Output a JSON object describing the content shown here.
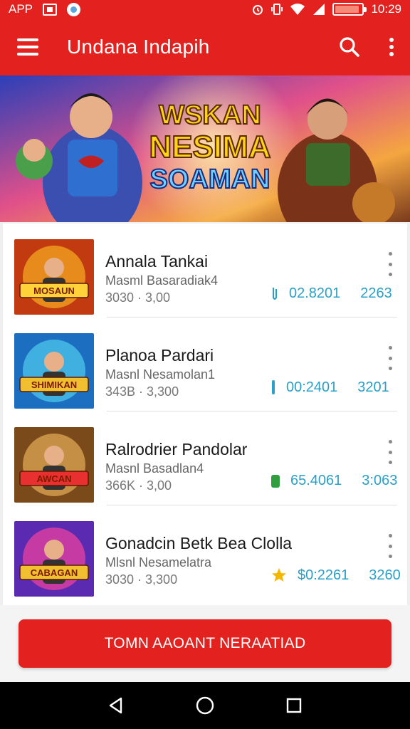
{
  "status_bar": {
    "left_text": "APP",
    "time": "10:29",
    "battery_level": 0.9,
    "icons": [
      "box-icon",
      "circle-app-icon",
      "alarm-icon",
      "vibrate-icon",
      "wifi-icon",
      "signal-icon",
      "battery-icon"
    ]
  },
  "app_bar": {
    "title": "Undana Indapih",
    "icons": [
      "menu-icon",
      "search-icon",
      "more-vert-icon"
    ]
  },
  "banner": {
    "line1": "WSKAN",
    "line2": "NESIMA",
    "line3": "SOAMAN"
  },
  "list": [
    {
      "title": "Annala Tankai",
      "subtitle": "Masml Basaradiak4",
      "meta": "3030 · 3,00",
      "stat_icon": "clip-icon",
      "stat_value": "02.8201",
      "stat_count": "2263",
      "thumb_text": "MOSAUN"
    },
    {
      "title": "Planoa Pardari",
      "subtitle": "Masnl Nesamolan1",
      "meta": "343B · 3,300",
      "stat_icon": "bar-icon",
      "stat_value": "00:2401",
      "stat_count": "3201",
      "thumb_text": "SHIMIKAN"
    },
    {
      "title": "Ralrodrier Pandolar",
      "subtitle": "Masnl Basadlan4",
      "meta": "366K · 3,00",
      "stat_icon": "green-tag-icon",
      "stat_value": "65.4061",
      "stat_count": "3:063",
      "thumb_text": "AWCAN"
    },
    {
      "title": "Gonadcin Betk Bea Clolla",
      "subtitle": "Mlsnl Nesamelatra",
      "meta": "3030 · 3,300",
      "stat_icon": "star-icon",
      "stat_value": "$0:2261",
      "stat_count": "3260",
      "thumb_text": "CABAGAN"
    }
  ],
  "cta": {
    "label": "TOMN AAOANT NERAATIAD"
  },
  "nav_bar": {
    "icons": [
      "back-icon",
      "home-icon",
      "recents-icon"
    ]
  },
  "colors": {
    "primary": "#e3221f",
    "stat": "#2aa0c8",
    "star": "#f5b800",
    "green": "#2e9e3e"
  }
}
